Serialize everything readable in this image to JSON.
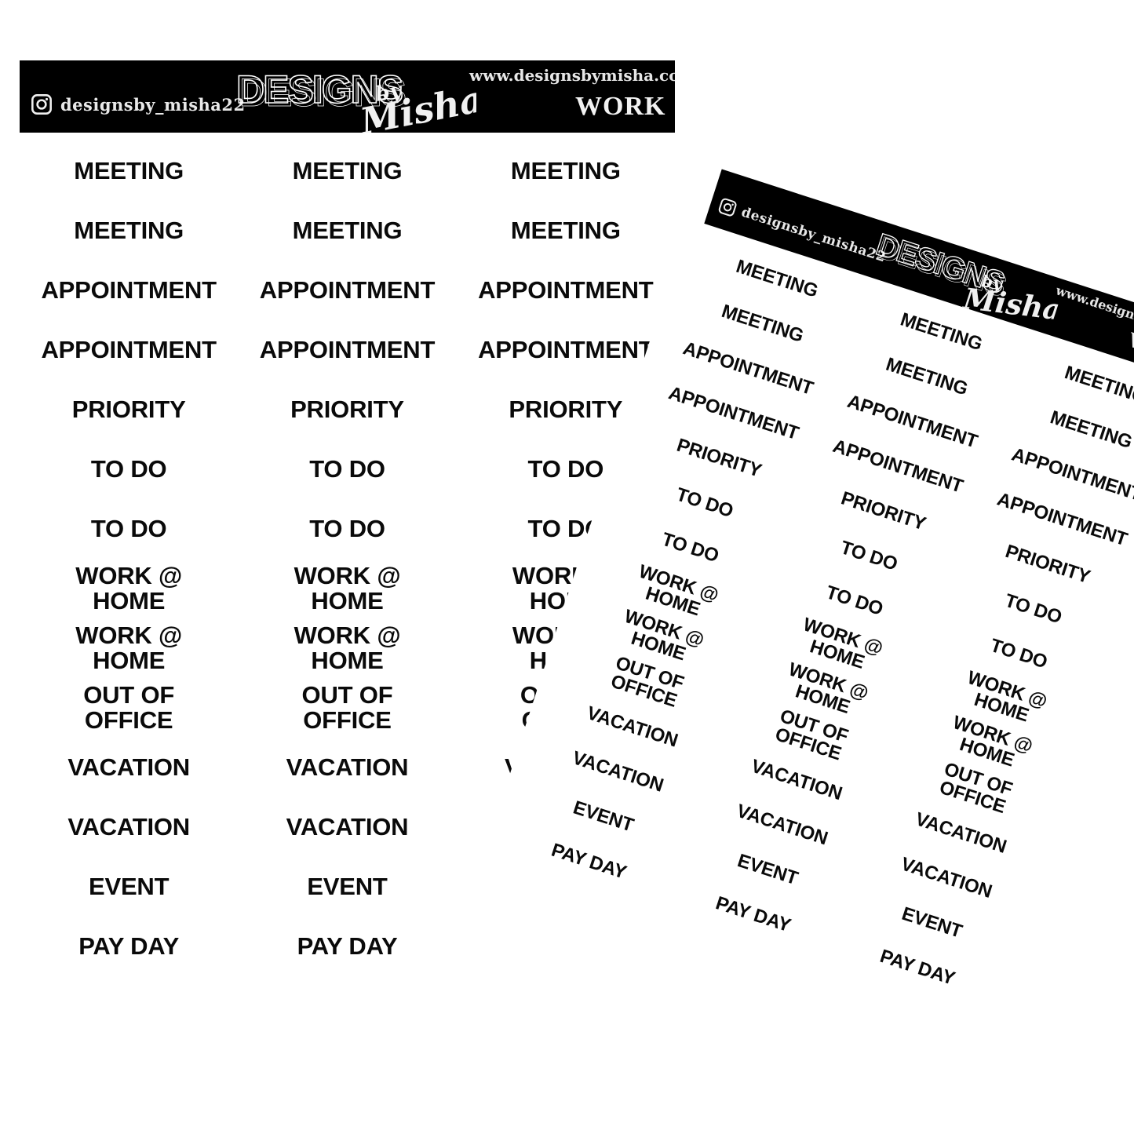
{
  "sheets": [
    {
      "id": "main",
      "orientation": "upright",
      "header": {
        "instagram_icon": "instagram-icon",
        "instagram_handle": "designsby_misha22",
        "brand_main": "DESIGNS",
        "brand_script": "by Misha",
        "website": "www.designsbymisha.com",
        "category": "WORK",
        "background_color": "#000000",
        "text_color": "#ffffff"
      },
      "columns": 3,
      "rows": [
        "MEETING",
        "MEETING",
        "APPOINTMENT",
        "APPOINTMENT",
        "PRIORITY",
        "TO DO",
        "TO DO",
        "WORK @\nHOME",
        "WORK @\nHOME",
        "OUT OF\nOFFICE",
        "VACATION",
        "VACATION",
        "EVENT",
        "PAY DAY"
      ]
    },
    {
      "id": "rotated",
      "orientation": "rotated-17.9deg",
      "header": {
        "instagram_icon": "instagram-icon",
        "instagram_handle": "designsby_misha22",
        "brand_main": "DESIGNS",
        "brand_script": "by Misha",
        "website": "www.designsbymisha.com",
        "category": "WORK",
        "background_color": "#000000",
        "text_color": "#ffffff"
      },
      "columns": 3,
      "rows": [
        "MEETING",
        "MEETING",
        "APPOINTMENT",
        "APPOINTMENT",
        "PRIORITY",
        "TO DO",
        "TO DO",
        "WORK @\nHOME",
        "WORK @\nHOME",
        "OUT OF\nOFFICE",
        "VACATION",
        "VACATION",
        "EVENT",
        "PAY DAY"
      ]
    }
  ],
  "colors": {
    "page_background": "#ffffff",
    "sticker_text": "#0a0a0a",
    "header_background": "#000000",
    "header_text": "#ffffff"
  }
}
